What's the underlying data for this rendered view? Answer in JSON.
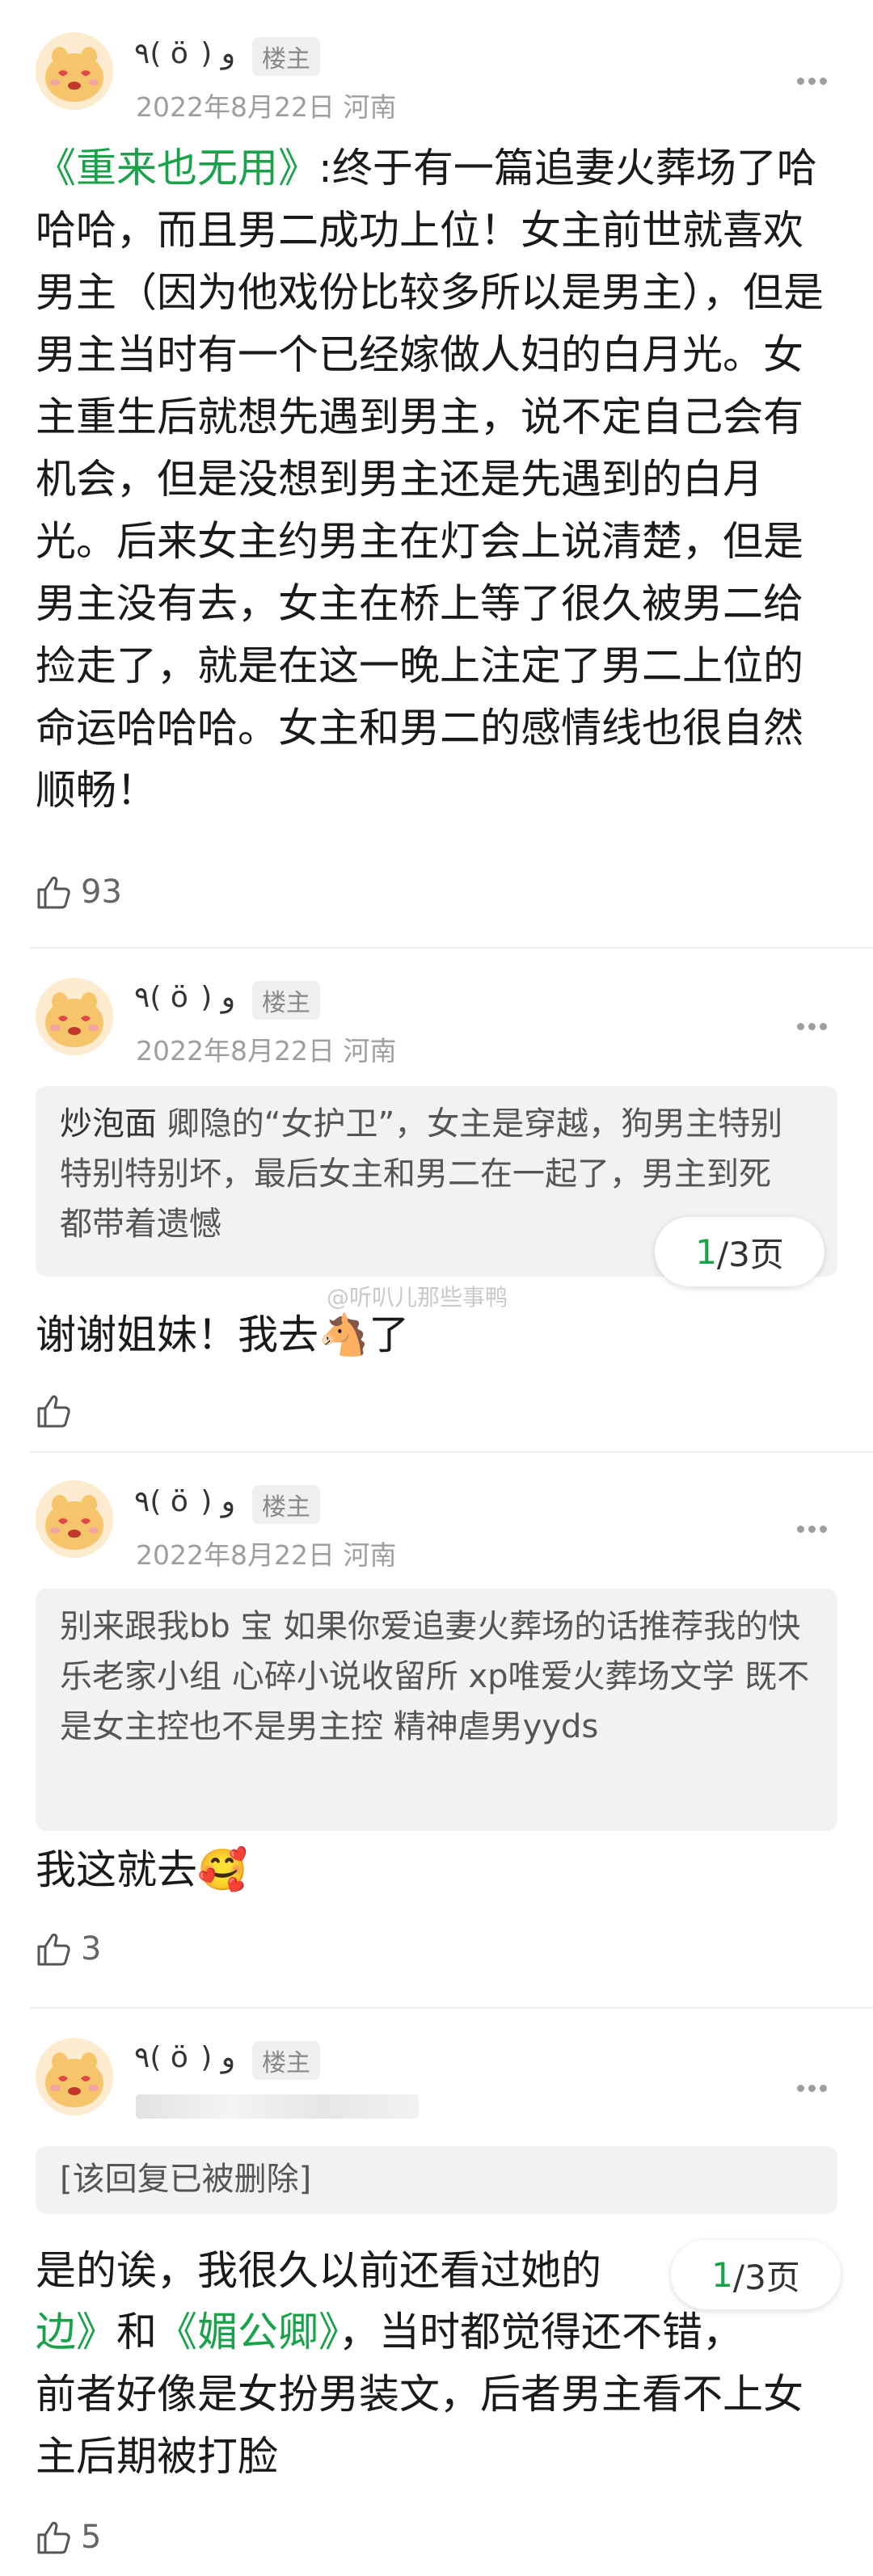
{
  "posts": [
    {
      "username": "٩( ö ) و",
      "badge": "楼主",
      "date": "2022年8月22日",
      "location": "河南",
      "title_link": "《重来也无用》",
      "text": ":终于有一篇追妻火葬场了哈哈哈，而且男二成功上位！女主前世就喜欢男主（因为他戏份比较多所以是男主），但是男主当时有一个已经嫁做人妇的白月光。女主重生后就想先遇到男主，说不定自己会有机会，但是没想到男主还是先遇到的白月光。后来女主约男主在灯会上说清楚，但是男主没有去，女主在桥上等了很久被男二给捡走了，就是在这一晚上注定了男二上位的命运哈哈哈。女主和男二的感情线也很自然顺畅！",
      "likes": "93"
    },
    {
      "username": "٩( ö ) و",
      "badge": "楼主",
      "date": "2022年8月22日",
      "location": "河南",
      "quote_name": "炒泡面",
      "quote_text": "卿隐的“女护卫”，女主是穿越，狗男主特别特别特别坏，最后女主和男二在一起了，男主到死都带着遗憾",
      "pager_current": "1",
      "pager_total": "/3页",
      "watermark": "@听叭儿那些事鸭",
      "reply_text": "谢谢姐妹！我去🐴了",
      "likes": ""
    },
    {
      "username": "٩( ö ) و",
      "badge": "楼主",
      "date": "2022年8月22日",
      "location": "河南",
      "quote_text": "别来跟我bb 宝 如果你爱追妻火葬场的话推荐我的快乐老家小组 心碎小说收留所 xp唯爱火葬场文学 既不是女主控也不是男主控 精神虐男yyds",
      "reply_text": "我这就去🥰",
      "likes": "3"
    },
    {
      "username": "٩( ö ) و",
      "badge": "楼主",
      "quote_text": "[该回复已被删除]",
      "pager_current": "1",
      "pager_total": "/3页",
      "reply_line1": "是的诶，我很久以前还看过她的",
      "reply_link1": "边》",
      "reply_and": "和",
      "reply_link2": "《媚公卿》",
      "reply_rest1": "，当时都觉得还不错，",
      "reply_rest2": "前者好像是女扮男装文，后者男主看不上女主后期被打脸",
      "likes": "5"
    }
  ],
  "colors": {
    "link_green": "#1aa24a",
    "meta_gray": "#9e9e9e",
    "quote_bg": "#f2f2f2"
  }
}
